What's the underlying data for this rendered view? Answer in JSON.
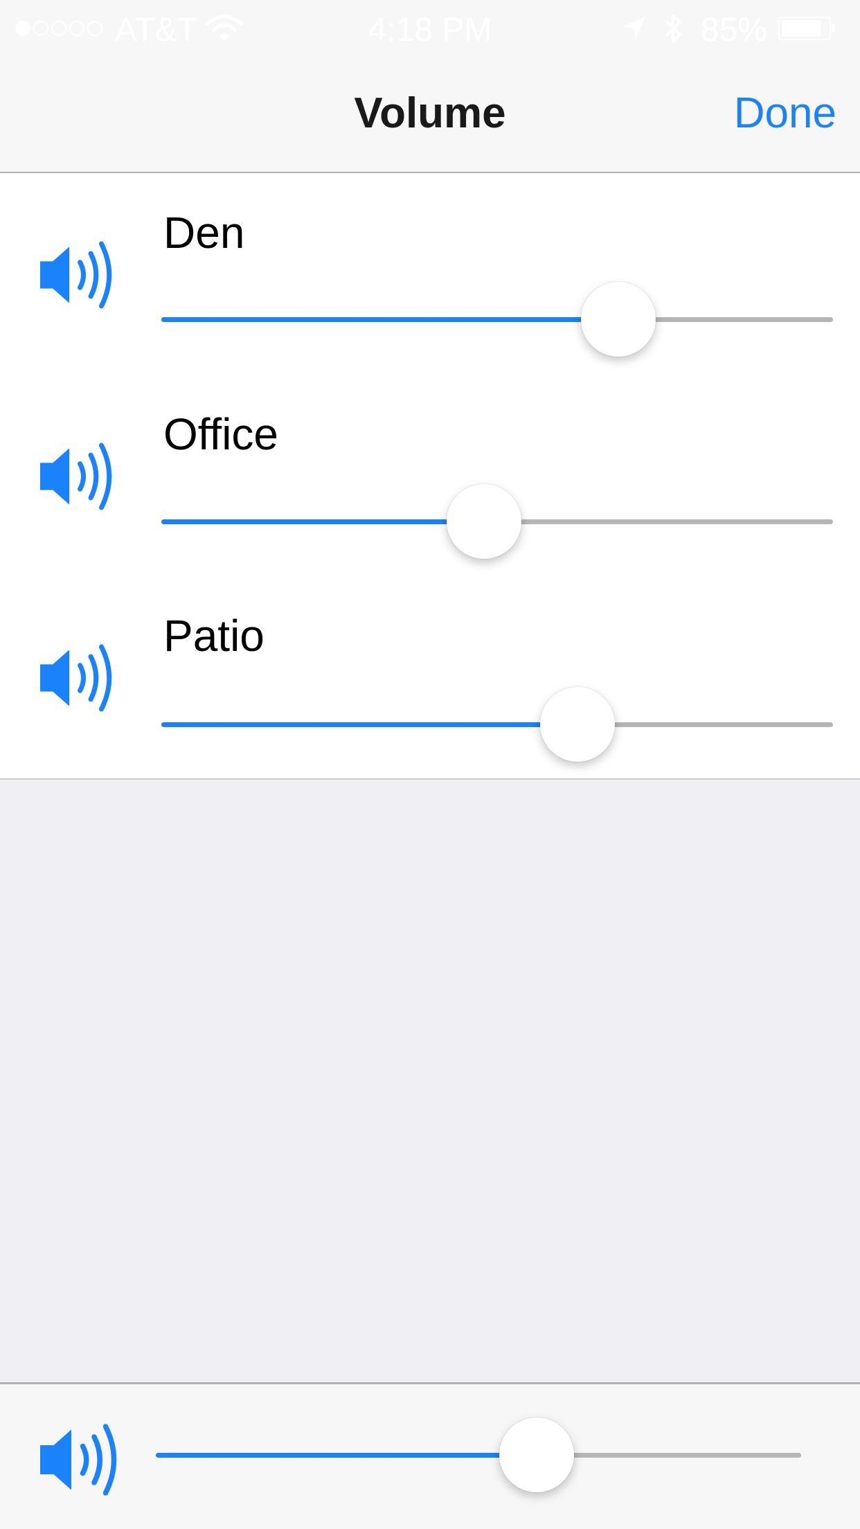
{
  "status_bar": {
    "carrier": "AT&T",
    "time": "4:18 PM",
    "battery_percent": "85%",
    "battery_level": 0.85,
    "signal_bars_filled": 1,
    "signal_bars_total": 5
  },
  "nav": {
    "title": "Volume",
    "done_label": "Done"
  },
  "rooms": [
    {
      "name": "Den",
      "volume": 0.68
    },
    {
      "name": "Office",
      "volume": 0.48
    },
    {
      "name": "Patio",
      "volume": 0.62
    }
  ],
  "master": {
    "volume": 0.59
  },
  "colors": {
    "accent": "#1a82fb",
    "track": "#b6b6b6",
    "list_background": "#ffffff",
    "page_background": "#efeff4",
    "bar_background": "#f7f7f7"
  },
  "icons": {
    "room_icon": "speaker-volume-icon",
    "master_icon": "speaker-volume-icon"
  }
}
